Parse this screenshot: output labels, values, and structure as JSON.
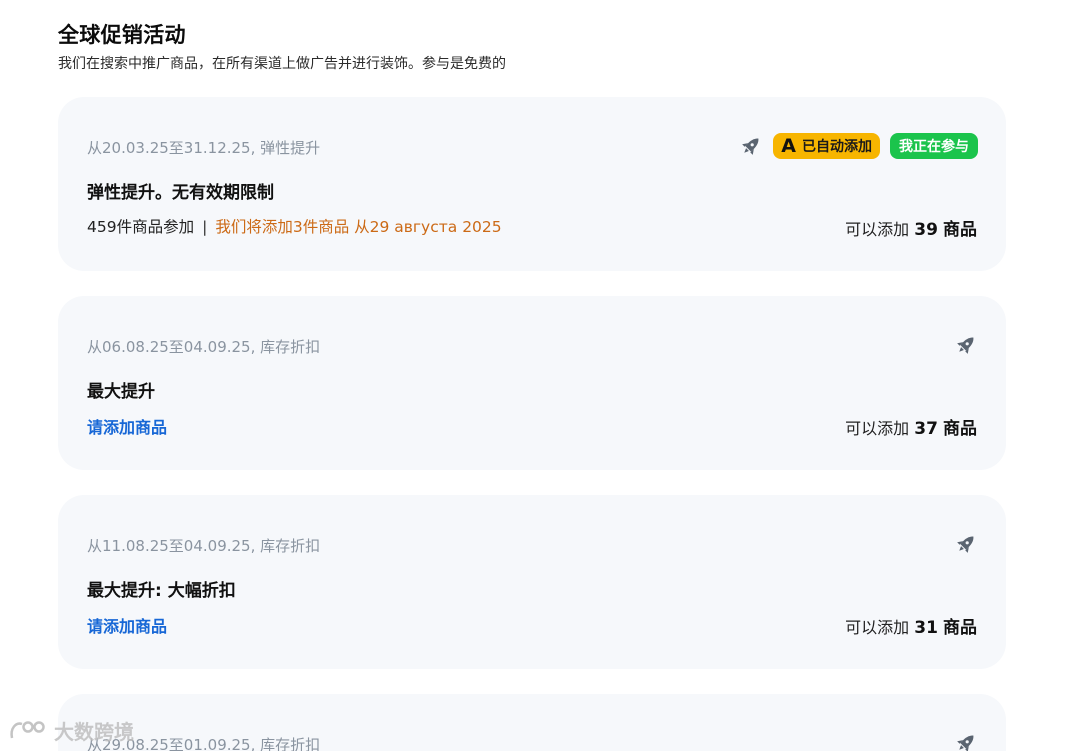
{
  "header": {
    "title": "全球促销活动",
    "subtitle": "我们在搜索中推广商品，在所有渠道上做广告并进行装饰。参与是免费的"
  },
  "promotions": [
    {
      "date_range": "从20.03.25至31.12.25, 弹性提升",
      "title": "弹性提升。无有效期限制",
      "participating": "459件商品参加",
      "separator": "|",
      "note": "我们将添加3件商品 从29 августа 2025",
      "can_add_label": "可以添加",
      "can_add_count": "39",
      "can_add_unit": "商品",
      "icon": "rocket-icon",
      "badge_auto_letter": "A",
      "badge_auto": "已自动添加",
      "badge_join": "我正在参与"
    },
    {
      "date_range": "从06.08.25至04.09.25, 库存折扣",
      "title": "最大提升",
      "add_link": "请添加商品",
      "can_add_label": "可以添加",
      "can_add_count": "37",
      "can_add_unit": "商品",
      "icon": "rocket-icon"
    },
    {
      "date_range": "从11.08.25至04.09.25, 库存折扣",
      "title": "最大提升: 大幅折扣",
      "add_link": "请添加商品",
      "can_add_label": "可以添加",
      "can_add_count": "31",
      "can_add_unit": "商品",
      "icon": "rocket-icon"
    },
    {
      "date_range": "从29.08.25至01.09.25, 库存折扣",
      "icon": "rocket-icon"
    }
  ],
  "watermark": {
    "text": "大数跨境"
  },
  "colors": {
    "card_bg": "#f6f8fb",
    "link_blue": "#1767d6",
    "note_orange": "#cc6a16",
    "badge_yellow": "#f7b500",
    "badge_green": "#1bc44c",
    "date_gray": "#8a94a0"
  }
}
